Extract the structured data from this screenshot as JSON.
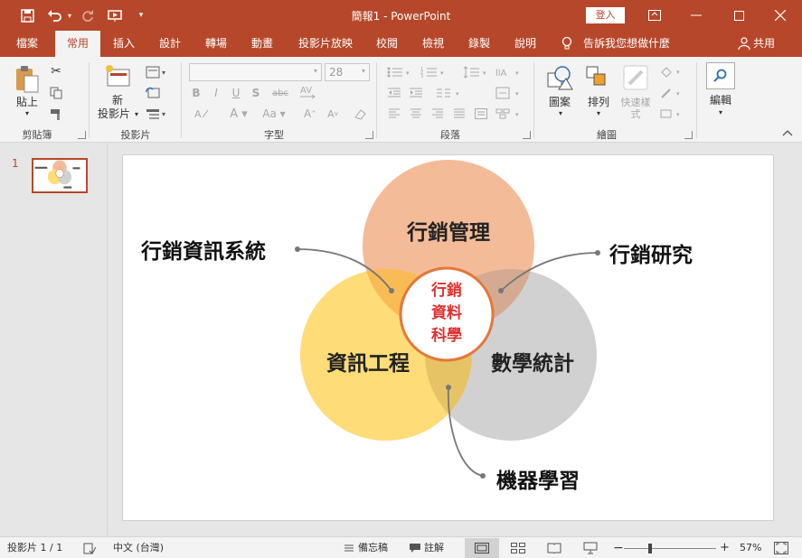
{
  "app": {
    "title": "簡報1 - PowerPoint",
    "signin": "登入"
  },
  "tabs": [
    {
      "label": "檔案"
    },
    {
      "label": "常用"
    },
    {
      "label": "插入"
    },
    {
      "label": "設計"
    },
    {
      "label": "轉場"
    },
    {
      "label": "動畫"
    },
    {
      "label": "投影片放映"
    },
    {
      "label": "校閱"
    },
    {
      "label": "檢視"
    },
    {
      "label": "錄製"
    },
    {
      "label": "說明"
    }
  ],
  "tell_me": "告訴我您想做什麼",
  "share": "共用",
  "ribbon": {
    "clipboard": {
      "paste": "貼上",
      "label": "剪貼簿"
    },
    "slides": {
      "new_slide_1": "新",
      "new_slide_2": "投影片",
      "label": "投影片"
    },
    "font": {
      "size": "28",
      "label": "字型"
    },
    "paragraph": {
      "label": "段落"
    },
    "drawing": {
      "shapes": "圖案",
      "arrange": "排列",
      "quick_styles_1": "快速樣",
      "quick_styles_2": "式",
      "label": "繪圖"
    },
    "editing": {
      "edit": "編輯"
    }
  },
  "thumbnail": {
    "number": "1"
  },
  "slide": {
    "circles": {
      "top": "行銷管理",
      "left": "資訊工程",
      "right": "數學統計"
    },
    "center": [
      "行銷",
      "資料",
      "科學"
    ],
    "callouts": {
      "top_left": "行銷資訊系統",
      "top_right": "行銷研究",
      "bottom": "機器學習"
    }
  },
  "colors": {
    "accent": "#b7472a",
    "circle_top": "#f4bb98",
    "circle_left": "#ffd966",
    "circle_right": "#cccccc",
    "center_text": "#e03030"
  },
  "status": {
    "slide": "投影片 1 / 1",
    "language": "中文 (台灣)",
    "notes": "備忘稿",
    "comments": "註解",
    "zoom": "57%"
  }
}
